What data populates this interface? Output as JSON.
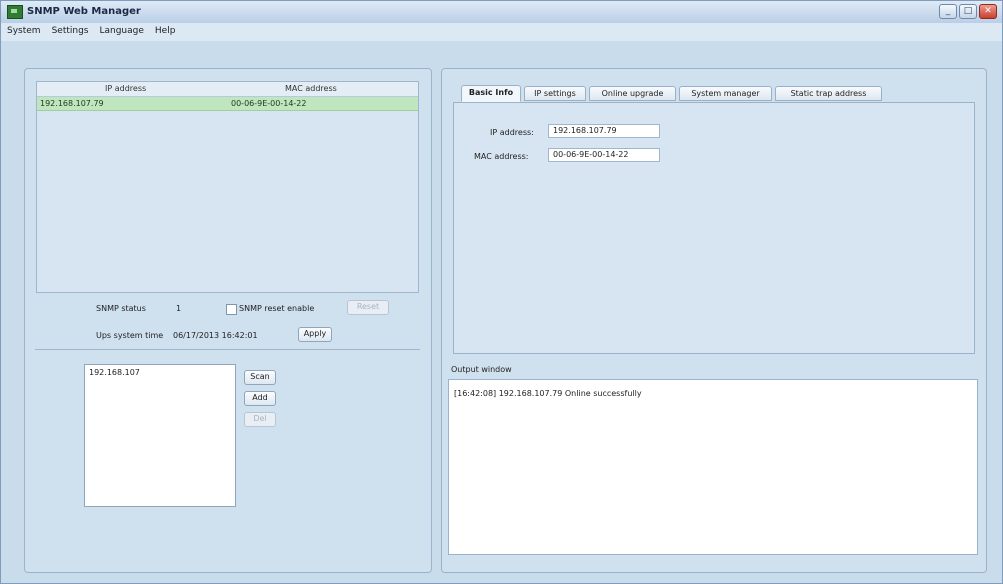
{
  "window": {
    "title": "SNMP Web Manager",
    "controls": {
      "minimize": "_",
      "maximize": "□",
      "close": "✕"
    }
  },
  "menu": [
    "System",
    "Settings",
    "Language",
    "Help"
  ],
  "device_table": {
    "columns": [
      "IP address",
      "MAC address"
    ],
    "rows": [
      {
        "ip": "192.168.107.79",
        "mac": "00-06-9E-00-14-22"
      }
    ]
  },
  "status": {
    "snmp_status_label": "SNMP status",
    "snmp_status_value": "1",
    "snmp_reset_label": "SNMP reset enable",
    "reset_button": "Reset",
    "ups_time_label": "Ups system time",
    "ups_time_value": "06/17/2013 16:42:01",
    "apply_button": "Apply"
  },
  "ip_list": {
    "items": [
      "192.168.107"
    ],
    "scan_button": "Scan",
    "add_button": "Add",
    "del_button": "Del"
  },
  "tabs": [
    "Basic Info",
    "IP settings",
    "Online upgrade",
    "System manager",
    "Static trap address"
  ],
  "basic_info": {
    "ip_label": "IP address:",
    "ip_value": "192.168.107.79",
    "mac_label": "MAC address:",
    "mac_value": "00-06-9E-00-14-22"
  },
  "output": {
    "label": "Output window",
    "lines": [
      "[16:42:08]   192.168.107.79 Online successfully"
    ]
  },
  "colors": {
    "window_bg": "#c9dcec",
    "selected_row": "#bfe6bf",
    "close_button": "#c8402e"
  }
}
